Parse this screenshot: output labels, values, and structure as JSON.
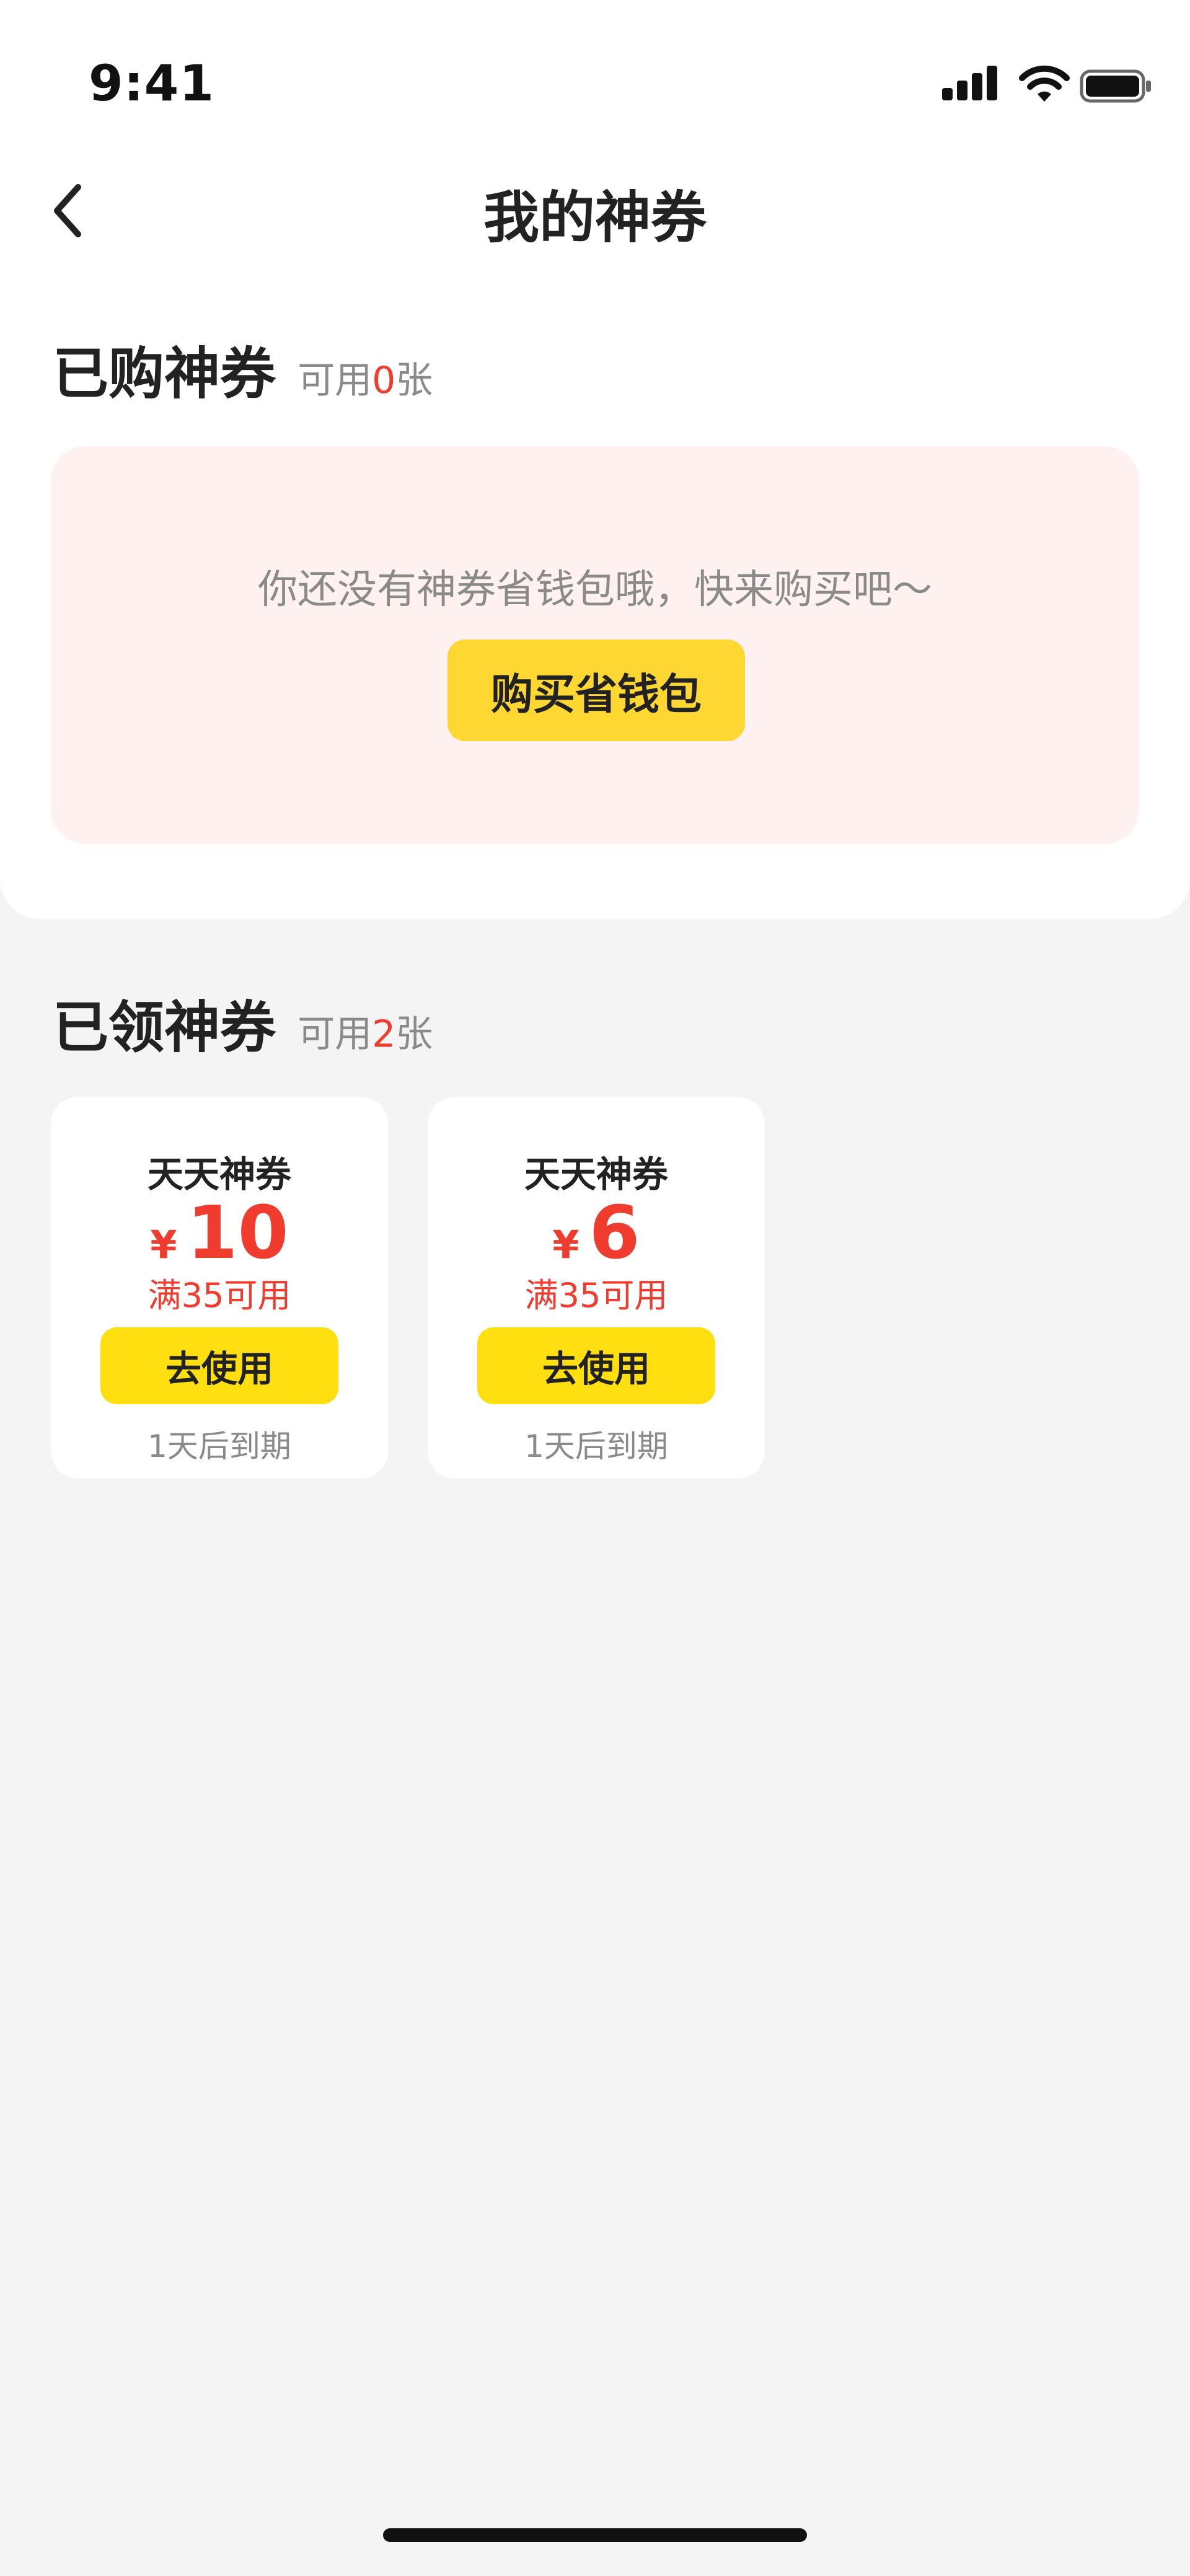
{
  "status_bar": {
    "time": "9:41",
    "icons": [
      "signal-icon",
      "wifi-icon",
      "battery-icon"
    ]
  },
  "nav": {
    "back_icon": "chevron-left-icon",
    "title": "我的神券"
  },
  "purchased": {
    "title": "已购神券",
    "count_prefix": "可用",
    "count": "0",
    "count_suffix": "张",
    "empty_text": "你还没有神券省钱包哦，快来购买吧～",
    "buy_button": "购买省钱包"
  },
  "received": {
    "title": "已领神券",
    "count_prefix": "可用",
    "count": "2",
    "count_suffix": "张",
    "coupons": [
      {
        "name": "天天神券",
        "currency": "¥",
        "amount": "10",
        "condition": "满35可用",
        "button": "去使用",
        "expiry": "1天后到期"
      },
      {
        "name": "天天神券",
        "currency": "¥",
        "amount": "6",
        "condition": "满35可用",
        "button": "去使用",
        "expiry": "1天后到期"
      }
    ]
  },
  "colors": {
    "accent_red": "#f03c2e",
    "button_yellow": "#ffdf0f",
    "empty_card_bg": "#fff1f0",
    "page_bg": "#f4f4f4"
  }
}
